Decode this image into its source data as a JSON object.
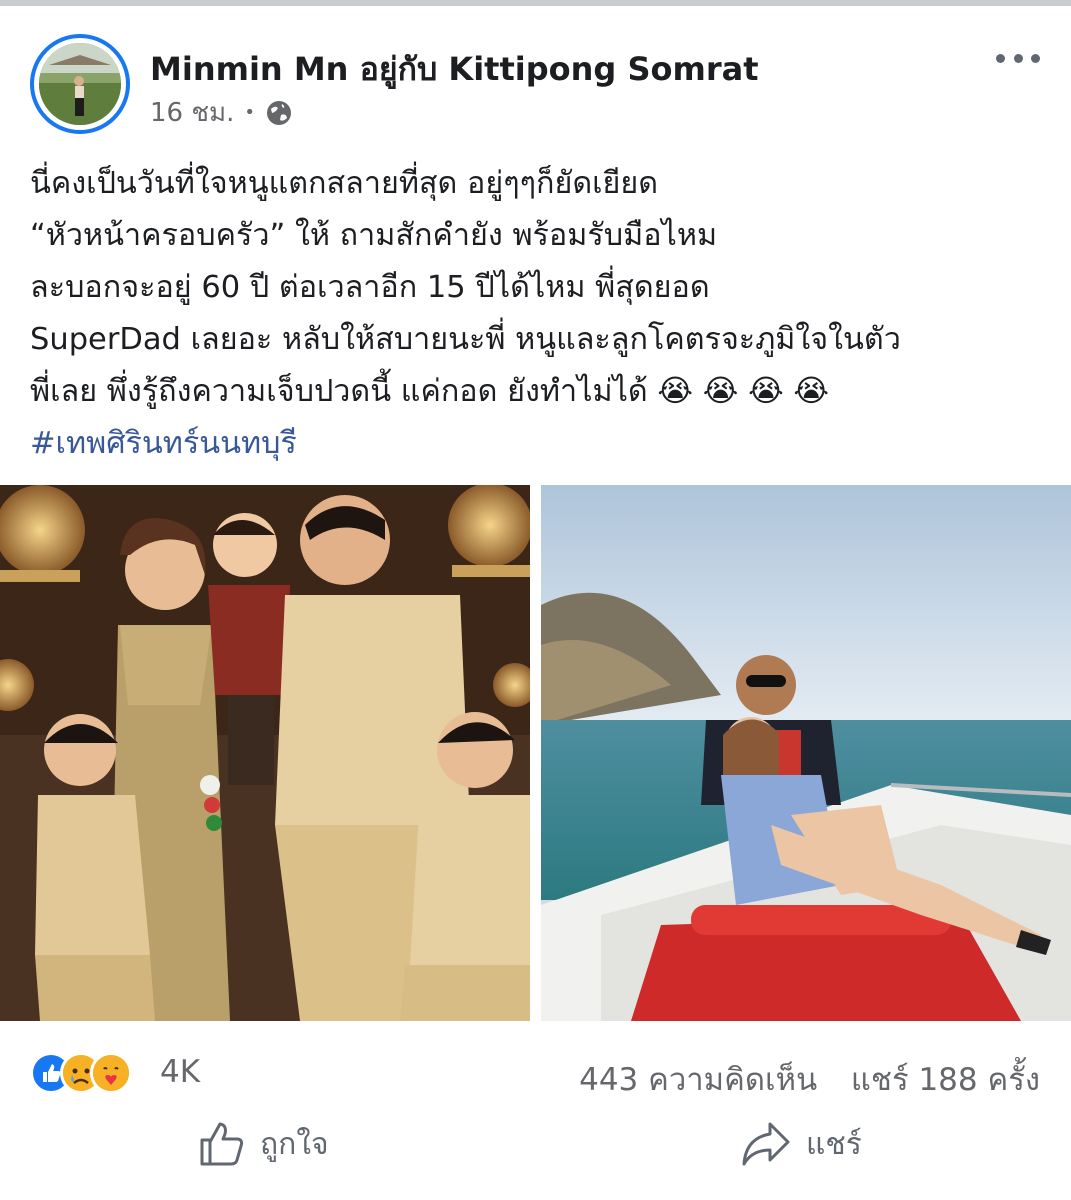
{
  "post": {
    "author": "Minmin Mn อยู่กับ Kittipong Somrat",
    "time": "16 ชม.",
    "separator": "•",
    "text_lines": [
      "นี่คงเป็นวันที่ใจหนูแตกสลายที่สุด อยู่ๆๆก็ยัดเยียด",
      "“หัวหน้าครอบครัว” ให้ ถามสักคำยัง พร้อมรับมือไหม",
      "ละบอกจะอยู่ 60 ปี ต่อเวลาอีก 15 ปีได้ไหม พี่สุดยอด",
      "SuperDad เลยอะ หลับให้สบายนะพี่ หนูและลูกโคตรจะภูมิใจในตัว",
      "พี่เลย พึ่งรู้ถึงความเจ็บปวดนี้ แค่กอด ยังทำไม่ได้ 😭 😭 😭 😭"
    ],
    "hashtag": "#เทพศิรินทร์นนทบุรี"
  },
  "stats": {
    "reaction_count": "4K",
    "comments": "443 ความคิดเห็น",
    "shares": "แชร์ 188 ครั้ง"
  },
  "actions": {
    "like_label": "ถูกใจ",
    "share_label": "แชร์"
  },
  "colors": {
    "accent": "#1877f2",
    "hashtag": "#385898",
    "secondary_text": "#65676b"
  },
  "icons": {
    "privacy": "globe-icon",
    "more": "more-dots-icon",
    "reactions": [
      "like-reaction-icon",
      "sad-reaction-icon",
      "care-reaction-icon"
    ],
    "like": "thumbs-up-icon",
    "share": "share-arrow-icon"
  }
}
